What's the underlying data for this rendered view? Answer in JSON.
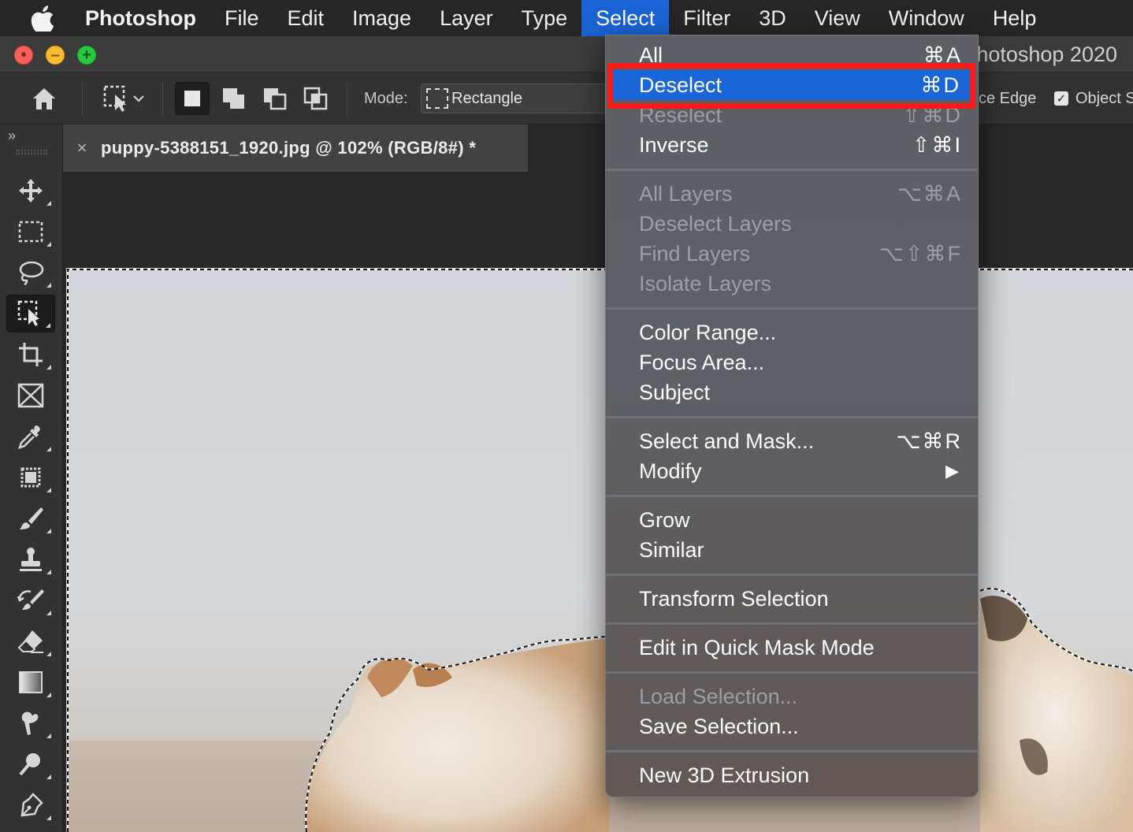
{
  "menubar": {
    "app_name": "Photoshop",
    "items": [
      "File",
      "Edit",
      "Image",
      "Layer",
      "Type",
      "Select",
      "Filter",
      "3D",
      "View",
      "Window",
      "Help"
    ],
    "active_item": "Select"
  },
  "window": {
    "title_visible": "hotoshop 2020"
  },
  "options_bar": {
    "mode_label": "Mode:",
    "mode_value": "Rectangle",
    "edge_label": "ce Edge",
    "object_label": "Object S",
    "object_checked": true
  },
  "document_tab": {
    "close_glyph": "×",
    "title": "puppy-5388151_1920.jpg @ 102% (RGB/8#) *"
  },
  "toolbar": {
    "collapse_glyph": "››",
    "tools": [
      "move",
      "marquee",
      "lasso",
      "object-selection",
      "crop",
      "frame",
      "eyedropper",
      "patch",
      "brush",
      "clone-stamp",
      "history-brush",
      "eraser",
      "gradient",
      "smudge",
      "dodge",
      "pen"
    ],
    "active_tool": "object-selection"
  },
  "select_menu": {
    "items": [
      {
        "label": "All",
        "shortcut": "⌘A",
        "disabled": false
      },
      {
        "label": "Deselect",
        "shortcut": "⌘D",
        "disabled": false,
        "highlighted": true
      },
      {
        "label": "Reselect",
        "shortcut": "⇧⌘D",
        "disabled": true
      },
      {
        "label": "Inverse",
        "shortcut": "⇧⌘I",
        "disabled": false
      },
      {
        "label": "All Layers",
        "shortcut": "⌥⌘A",
        "disabled": true
      },
      {
        "label": "Deselect Layers",
        "shortcut": "",
        "disabled": true
      },
      {
        "label": "Find Layers",
        "shortcut": "⌥⇧⌘F",
        "disabled": true
      },
      {
        "label": "Isolate Layers",
        "shortcut": "",
        "disabled": true
      },
      {
        "label": "Color Range...",
        "shortcut": "",
        "disabled": false
      },
      {
        "label": "Focus Area...",
        "shortcut": "",
        "disabled": false
      },
      {
        "label": "Subject",
        "shortcut": "",
        "disabled": false
      },
      {
        "label": "Select and Mask...",
        "shortcut": "⌥⌘R",
        "disabled": false
      },
      {
        "label": "Modify",
        "shortcut": "▶",
        "disabled": false
      },
      {
        "label": "Grow",
        "shortcut": "",
        "disabled": false
      },
      {
        "label": "Similar",
        "shortcut": "",
        "disabled": false
      },
      {
        "label": "Transform Selection",
        "shortcut": "",
        "disabled": false
      },
      {
        "label": "Edit in Quick Mask Mode",
        "shortcut": "",
        "disabled": false
      },
      {
        "label": "Load Selection...",
        "shortcut": "",
        "disabled": true
      },
      {
        "label": "Save Selection...",
        "shortcut": "",
        "disabled": false
      },
      {
        "label": "New 3D Extrusion",
        "shortcut": "",
        "disabled": false
      }
    ]
  },
  "colors": {
    "menu_highlight": "#1a66d9",
    "annotation_box": "#ff1a1a",
    "menubar_active": "#1a63d6"
  }
}
